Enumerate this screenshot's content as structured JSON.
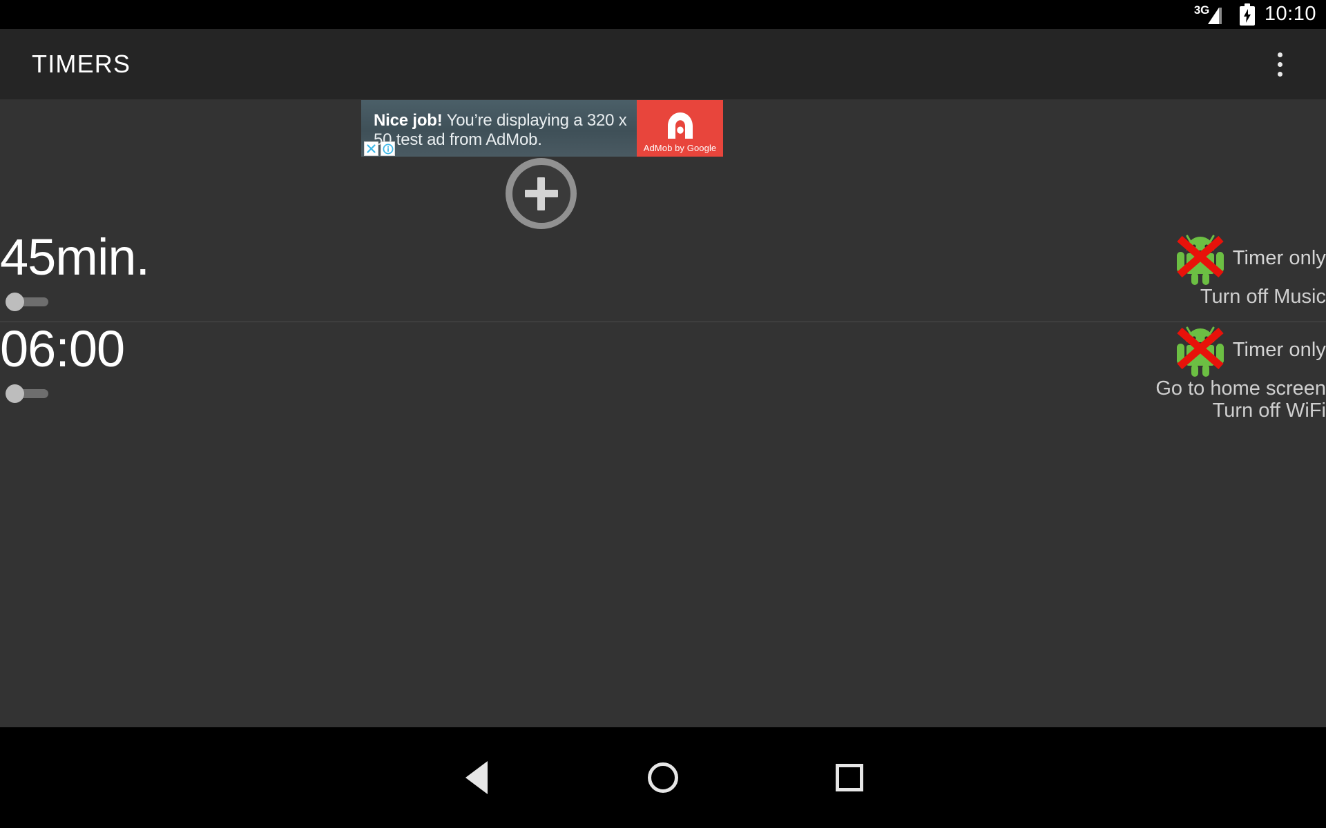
{
  "status_bar": {
    "network_label": "3G",
    "network_icon": "signal-bars-icon",
    "battery_icon": "battery-charging-icon",
    "time": "10:10"
  },
  "app_bar": {
    "title": "TIMERS",
    "overflow_icon": "overflow-menu-icon"
  },
  "ad": {
    "headline": "Nice job!",
    "body": "You’re displaying a 320 x 50 test ad from AdMob.",
    "close_icon": "close-x-icon",
    "info_icon": "info-icon",
    "brand_caption": "AdMob by Google",
    "brand_icon": "admob-logo-icon",
    "brand_color": "#e8453c",
    "panel_color": "#44555d"
  },
  "add_button": {
    "icon": "plus-icon",
    "label": "Add timer"
  },
  "timers": [
    {
      "time": "45min.",
      "enabled": false,
      "toggle_icon": "toggle-switch-off",
      "status_icon": "android-disabled-icon",
      "status_label": "Timer only",
      "actions": [
        "Turn off Music"
      ]
    },
    {
      "time": "06:00",
      "enabled": false,
      "toggle_icon": "toggle-switch-off",
      "status_icon": "android-disabled-icon",
      "status_label": "Timer only",
      "actions": [
        "Go to home screen",
        "Turn off WiFi"
      ]
    }
  ],
  "nav_bar": {
    "back_label": "Back",
    "back_icon": "back-triangle-icon",
    "home_label": "Home",
    "home_icon": "home-circle-icon",
    "recents_label": "Recents",
    "recents_icon": "recents-square-icon"
  },
  "colors": {
    "background": "#333333",
    "app_bar": "#252525",
    "system": "#000000",
    "robot_green": "#6cbf43",
    "x_red": "#e8120a"
  }
}
